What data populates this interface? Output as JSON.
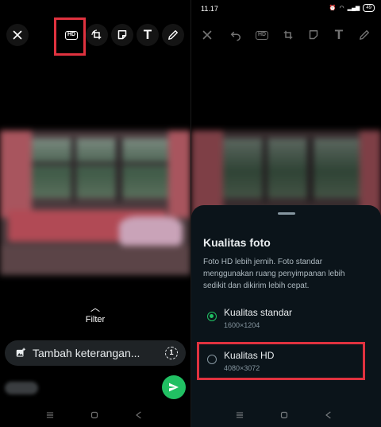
{
  "left_panel": {
    "toolbar": {
      "close_icon": "close-icon",
      "hd_label": "HD",
      "icons": [
        "hd-quality-icon",
        "crop-rotate-icon",
        "sticker-icon",
        "text-icon",
        "pencil-icon"
      ],
      "text_tool_glyph": "T"
    },
    "filter_label": "Filter",
    "caption_placeholder": "Tambah keterangan...",
    "view_once_label": "1",
    "colors": {
      "send": "#21c063",
      "highlight": "#e0323f"
    }
  },
  "right_panel": {
    "status_bar": {
      "time": "11.17",
      "battery": "49"
    },
    "toolbar": {
      "hd_label": "HD",
      "text_tool_glyph": "T",
      "icons": [
        "close-icon",
        "undo-icon",
        "hd-quality-icon",
        "crop-rotate-icon",
        "sticker-icon",
        "text-icon",
        "pencil-icon"
      ]
    },
    "sheet": {
      "title": "Kualitas foto",
      "description": "Foto HD lebih jernih. Foto standar menggunakan ruang penyimpanan lebih sedikit dan dikirim lebih cepat.",
      "options": [
        {
          "label": "Kualitas standar",
          "resolution": "1600×1204",
          "selected": true
        },
        {
          "label": "Kualitas HD",
          "resolution": "4080×3072",
          "selected": false
        }
      ]
    }
  }
}
